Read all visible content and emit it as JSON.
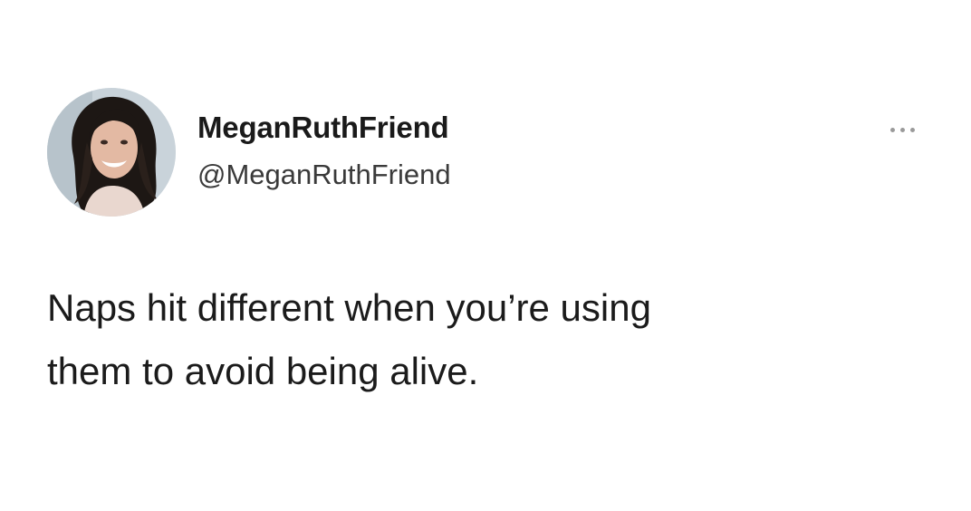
{
  "tweet": {
    "display_name": "MeganRuthFriend",
    "handle": "@MeganRuthFriend",
    "text": "Naps hit different when you’re using\nthem to avoid being alive.",
    "avatar_icon": "profile-photo",
    "more_icon": "more-options-icon"
  },
  "colors": {
    "background": "#ffffff",
    "text": "#1b1b1b",
    "handle": "#3a3a3a",
    "more_dots": "#9a9a9a"
  }
}
